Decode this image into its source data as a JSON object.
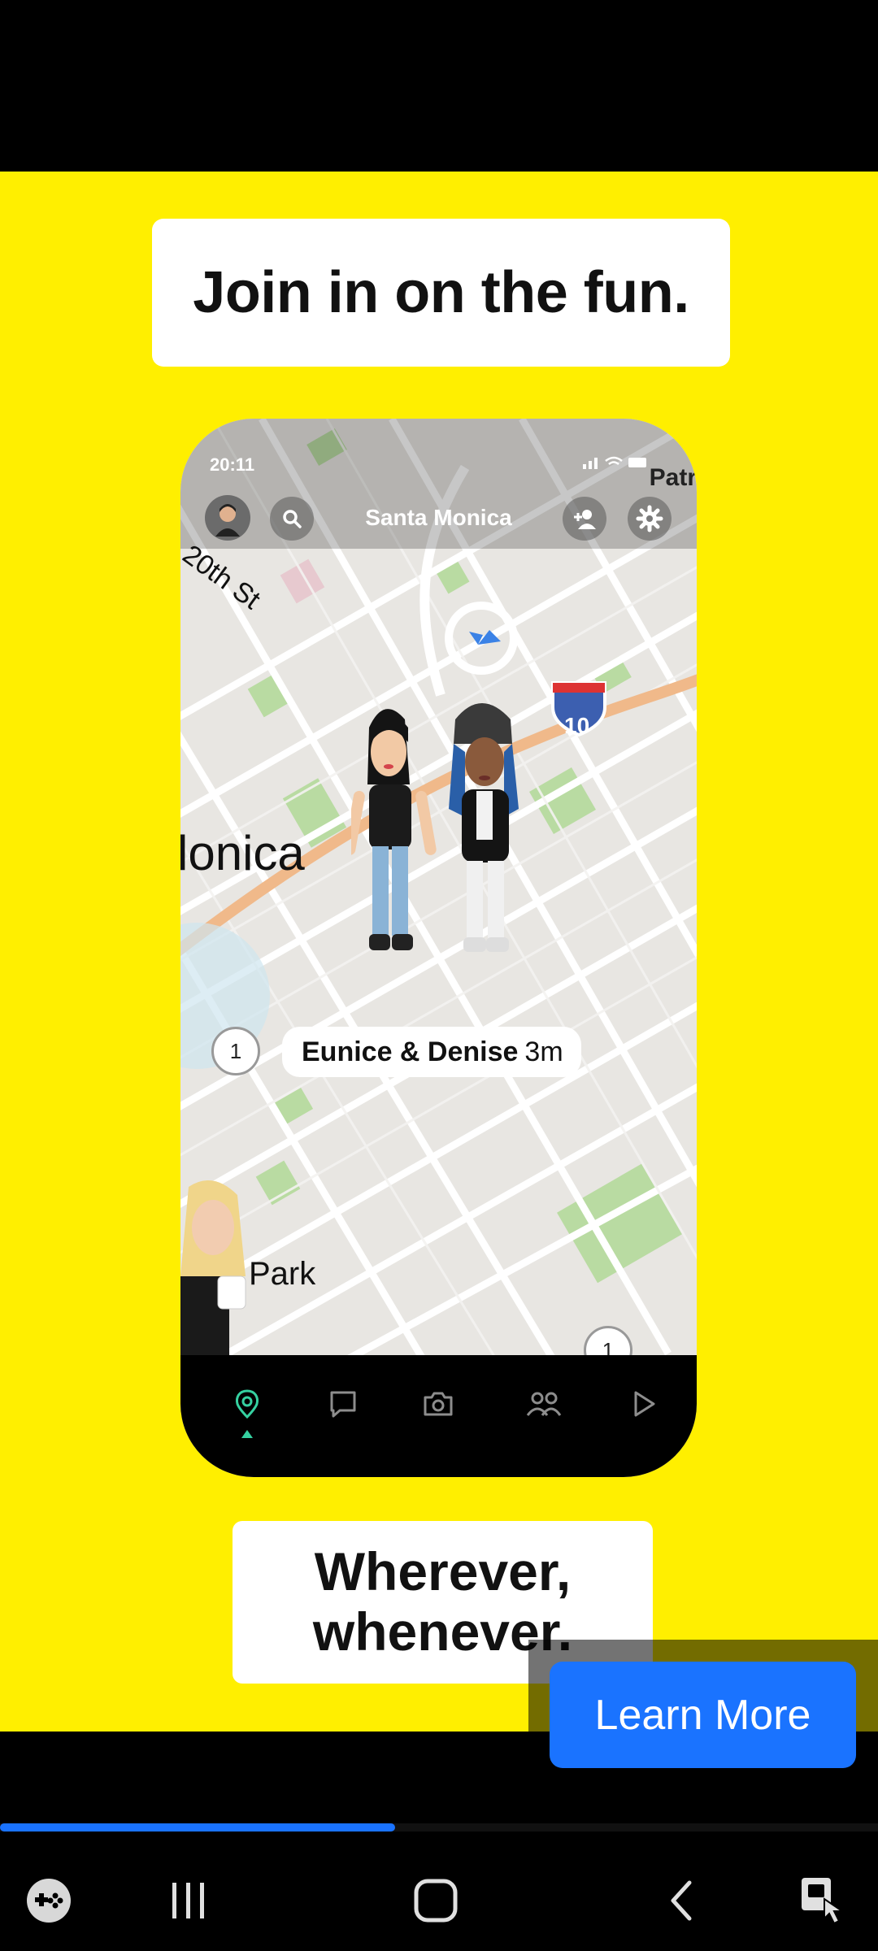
{
  "ad": {
    "headline": "Join in on the fun.",
    "tagline_line1": "Wherever,",
    "tagline_line2": "whenever.",
    "cta_label": "Learn More",
    "background_color": "#FFEF00",
    "cta_color": "#1a73ff"
  },
  "phone": {
    "status_time": "20:11",
    "status_icons": "signal-icon wifi-icon battery-icon",
    "corner_label": "Patr",
    "location_title": "Santa Monica",
    "map_labels": {
      "street": "20th St",
      "city": "lonica",
      "park": "Park",
      "highway_shield": "10"
    },
    "friend_label": {
      "names": "Eunice & Denise",
      "time": "3m"
    },
    "cluster_badges": [
      "1",
      "1"
    ],
    "nav_icons": [
      "map-pin-icon",
      "chat-icon",
      "camera-icon",
      "friends-icon",
      "play-icon"
    ],
    "active_tab": "map-pin-icon"
  },
  "video": {
    "progress": 0.45
  },
  "system_nav": {
    "buttons": [
      "game-launcher-icon",
      "recent-apps-icon",
      "home-icon",
      "back-icon",
      "accessibility-icon"
    ]
  }
}
